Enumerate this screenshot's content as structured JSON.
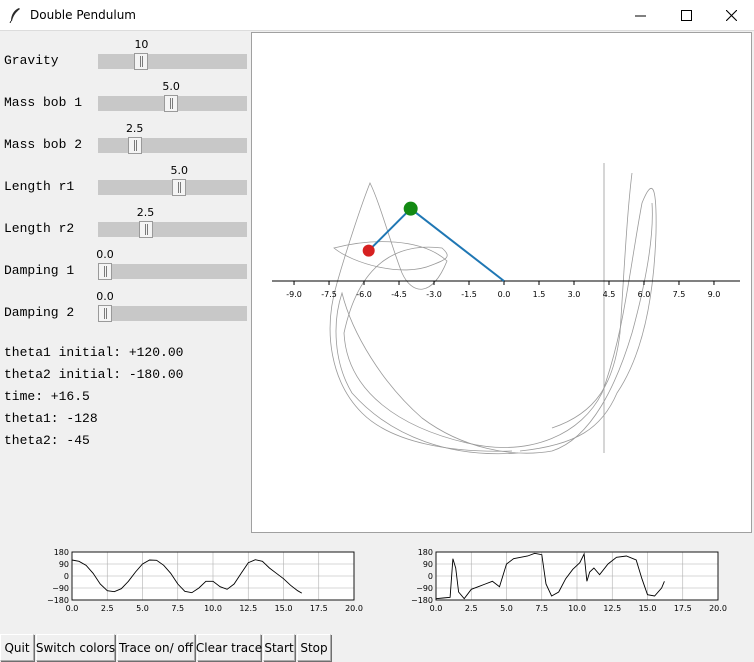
{
  "window": {
    "title": "Double Pendulum"
  },
  "sliders": [
    {
      "label": "Gravity",
      "value": "10",
      "fraction": 0.27
    },
    {
      "label": "Mass bob 1",
      "value": "5.0",
      "fraction": 0.49
    },
    {
      "label": "Mass bob 2",
      "value": "2.5",
      "fraction": 0.22
    },
    {
      "label": "Length r1",
      "value": "5.0",
      "fraction": 0.55
    },
    {
      "label": "Length r2",
      "value": "2.5",
      "fraction": 0.3
    },
    {
      "label": "Damping 1",
      "value": "0.0",
      "fraction": 0.0
    },
    {
      "label": "Damping 2",
      "value": "0.0",
      "fraction": 0.0
    }
  ],
  "info": {
    "theta1_initial": "theta1 initial: +120.00",
    "theta2_initial": "theta2 initial: -180.00",
    "time": "time: +16.5",
    "theta1": "theta1: -128",
    "theta2": "theta2: -45"
  },
  "pendulum": {
    "axis_ticks": [
      "-9.0",
      "-7.5",
      "-6.0",
      "-4.5",
      "-3.0",
      "-1.5",
      "0.0",
      "1.5",
      "3.0",
      "4.5",
      "6.0",
      "7.5",
      "9.0"
    ],
    "pivot": [
      0,
      0
    ],
    "bob1": [
      -4.0,
      3.1
    ],
    "bob2": [
      -5.8,
      1.3
    ],
    "colors": {
      "rod": "#1f77b4",
      "bob1": "#138a13",
      "bob2": "#d62020",
      "trace": "#9a9a9a"
    }
  },
  "chart_data": [
    {
      "type": "line",
      "x": [
        0,
        0.5,
        1.0,
        1.5,
        2.0,
        2.5,
        3.0,
        3.5,
        4.0,
        4.5,
        5.0,
        5.5,
        6.0,
        6.5,
        7.0,
        7.5,
        8.0,
        8.5,
        9.0,
        9.5,
        10.0,
        10.5,
        11.0,
        11.5,
        12.0,
        12.5,
        13.0,
        13.5,
        14.0,
        14.5,
        15.0,
        15.5,
        16.0,
        16.3
      ],
      "y": [
        120,
        110,
        80,
        20,
        -60,
        -110,
        -118,
        -95,
        -40,
        30,
        90,
        120,
        118,
        80,
        20,
        -60,
        -115,
        -125,
        -90,
        -40,
        -40,
        -80,
        -100,
        -60,
        20,
        100,
        122,
        110,
        60,
        20,
        -20,
        -70,
        -110,
        -128
      ],
      "xticks": [
        "0.0",
        "2.5",
        "5.0",
        "7.5",
        "10.0",
        "12.5",
        "15.0",
        "17.5",
        "20.0"
      ],
      "yticks": [
        "180",
        "90",
        "0",
        "−90",
        "−180"
      ],
      "xlim": [
        0,
        20
      ],
      "ylim": [
        -180,
        180
      ]
    },
    {
      "type": "line",
      "x": [
        0,
        0.5,
        1.0,
        1.2,
        1.4,
        1.6,
        2.0,
        2.5,
        3.0,
        3.5,
        4.0,
        4.5,
        5.0,
        5.5,
        6.0,
        6.5,
        7.0,
        7.5,
        7.8,
        8.2,
        8.7,
        9.2,
        9.7,
        10.2,
        10.5,
        10.7,
        10.9,
        11.2,
        11.6,
        12.2,
        12.8,
        13.5,
        14.2,
        14.6,
        15.0,
        15.5,
        16.0,
        16.2
      ],
      "y": [
        -170,
        -165,
        -160,
        130,
        60,
        -120,
        -170,
        -100,
        -80,
        -60,
        -40,
        -80,
        90,
        130,
        140,
        150,
        170,
        160,
        -60,
        -150,
        -120,
        -20,
        50,
        100,
        165,
        -40,
        30,
        60,
        10,
        90,
        140,
        150,
        120,
        -20,
        -140,
        -150,
        -90,
        -40
      ],
      "xticks": [
        "0.0",
        "2.5",
        "5.0",
        "7.5",
        "10.0",
        "12.5",
        "15.0",
        "17.5",
        "20.0"
      ],
      "yticks": [
        "180",
        "90",
        "0",
        "−90",
        "−180"
      ],
      "xlim": [
        0,
        20
      ],
      "ylim": [
        -180,
        180
      ]
    }
  ],
  "buttons": [
    "Quit",
    "Switch colors",
    "Trace on/ off",
    "Clear trace",
    "Start",
    "Stop"
  ]
}
